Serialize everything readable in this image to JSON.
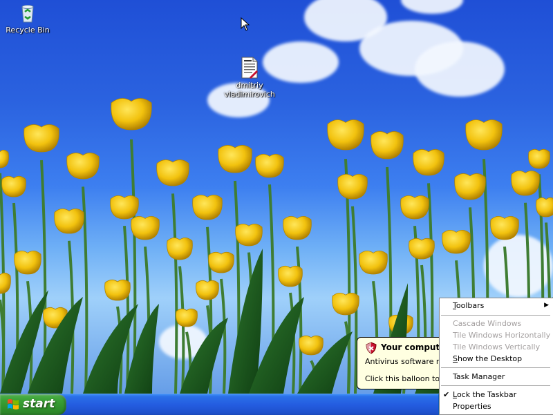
{
  "desktop": {
    "icons": [
      {
        "label_lines": [
          "Recycle Bin"
        ],
        "icon": "recycle-bin-icon"
      },
      {
        "label_lines": [
          "dmitriy",
          "vladimirovich"
        ],
        "icon": "document-icon"
      }
    ]
  },
  "balloon": {
    "icon": "security-shield-icon",
    "title": "Your computer",
    "line1": "Antivirus software mig",
    "line2": "Click this balloon to fix"
  },
  "taskbar": {
    "start_label": "start",
    "colors": {
      "start_green": "#3aa035",
      "bar_blue": "#245de0",
      "tray_blue": "#138fe0"
    }
  },
  "context_menu": {
    "items": [
      {
        "label": "Toolbars",
        "mnemonic": "T",
        "rest": "oolbars",
        "enabled": true,
        "submenu": true
      },
      {
        "label": "Cascade Windows",
        "enabled": false
      },
      {
        "label": "Tile Windows Horizontally",
        "enabled": false
      },
      {
        "label": "Tile Windows Vertically",
        "enabled": false
      },
      {
        "label": "Show the Desktop",
        "mnemonic": "S",
        "rest": "how the Desktop",
        "enabled": true
      },
      {
        "label": "Task Manager",
        "mnemonic": "K",
        "enabled": true
      },
      {
        "label": "Lock the Taskbar",
        "mnemonic": "L",
        "rest": "ock the Taskbar",
        "enabled": true,
        "checked": true
      },
      {
        "label": "Properties",
        "mnemonic": "R",
        "enabled": true
      }
    ],
    "check_glyph": "✔",
    "submenu_glyph": "▶"
  }
}
